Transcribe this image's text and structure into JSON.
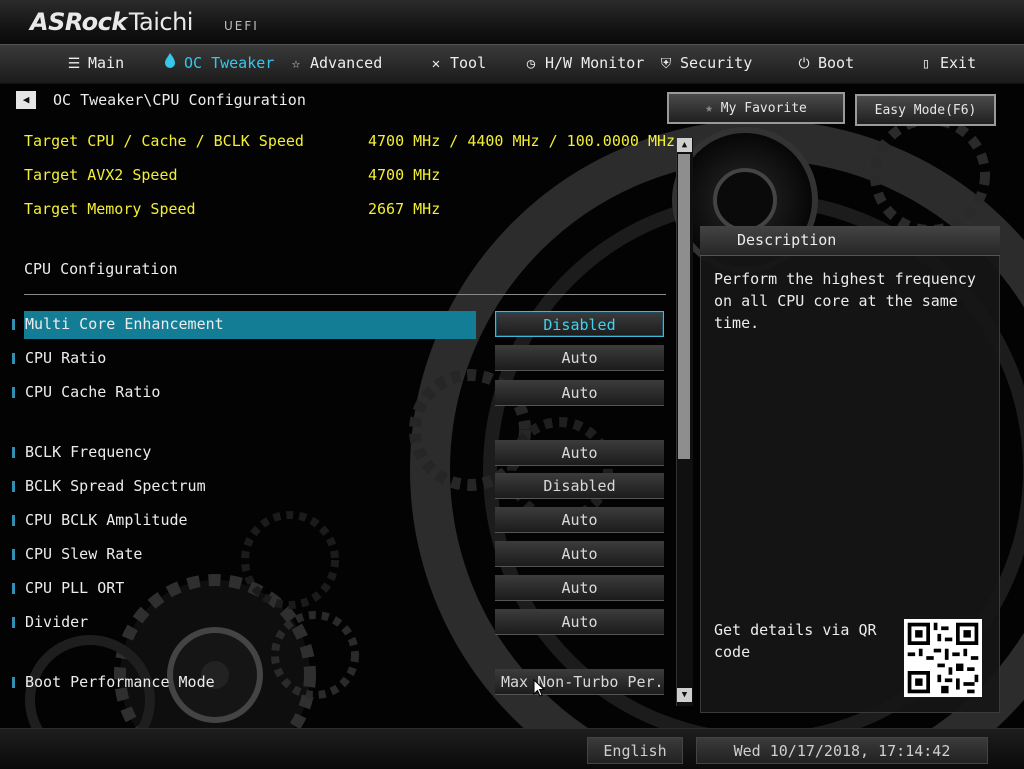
{
  "brand": {
    "logo": "ASRock",
    "model": "Taichi",
    "uefi": "UEFI"
  },
  "nav": {
    "tabs": [
      {
        "label": "Main",
        "icon": "list-icon"
      },
      {
        "label": "OC Tweaker",
        "icon": "flame-icon",
        "active": true
      },
      {
        "label": "Advanced",
        "icon": "star-icon"
      },
      {
        "label": "Tool",
        "icon": "tools-icon"
      },
      {
        "label": "H/W Monitor",
        "icon": "monitor-icon"
      },
      {
        "label": "Security",
        "icon": "shield-icon"
      },
      {
        "label": "Boot",
        "icon": "power-icon"
      },
      {
        "label": "Exit",
        "icon": "exit-icon"
      }
    ]
  },
  "breadcrumb": "OC Tweaker\\CPU Configuration",
  "buttons": {
    "favorite": "My Favorite",
    "easy_mode": "Easy Mode(F6)"
  },
  "targets": [
    {
      "label": "Target CPU / Cache / BCLK Speed",
      "value": "4700 MHz / 4400 MHz / 100.0000 MHz"
    },
    {
      "label": "Target AVX2 Speed",
      "value": "4700 MHz"
    },
    {
      "label": "Target Memory Speed",
      "value": "2667 MHz"
    }
  ],
  "section_title": "CPU Configuration",
  "settings": [
    {
      "label": "Multi Core Enhancement",
      "value": "Disabled",
      "selected": true
    },
    {
      "label": "CPU Ratio",
      "value": "Auto"
    },
    {
      "label": "CPU Cache Ratio",
      "value": "Auto"
    },
    {
      "label": "BCLK Frequency",
      "value": "Auto"
    },
    {
      "label": "BCLK Spread Spectrum",
      "value": "Disabled"
    },
    {
      "label": "CPU BCLK Amplitude",
      "value": "Auto"
    },
    {
      "label": "CPU Slew Rate",
      "value": "Auto"
    },
    {
      "label": "CPU PLL ORT",
      "value": "Auto"
    },
    {
      "label": "Divider",
      "value": "Auto"
    },
    {
      "label": "Boot Performance Mode",
      "value": "Max Non-Turbo Per..."
    }
  ],
  "description": {
    "title": "Description",
    "text": "Perform the highest frequency on all CPU core at the same time.",
    "qr_text": "Get details via QR code"
  },
  "status": {
    "language": "English",
    "datetime": "Wed 10/17/2018, 17:14:42"
  },
  "colors": {
    "accent": "#35c8ea",
    "highlight": "#147d96",
    "target_text": "#f3ef35"
  }
}
